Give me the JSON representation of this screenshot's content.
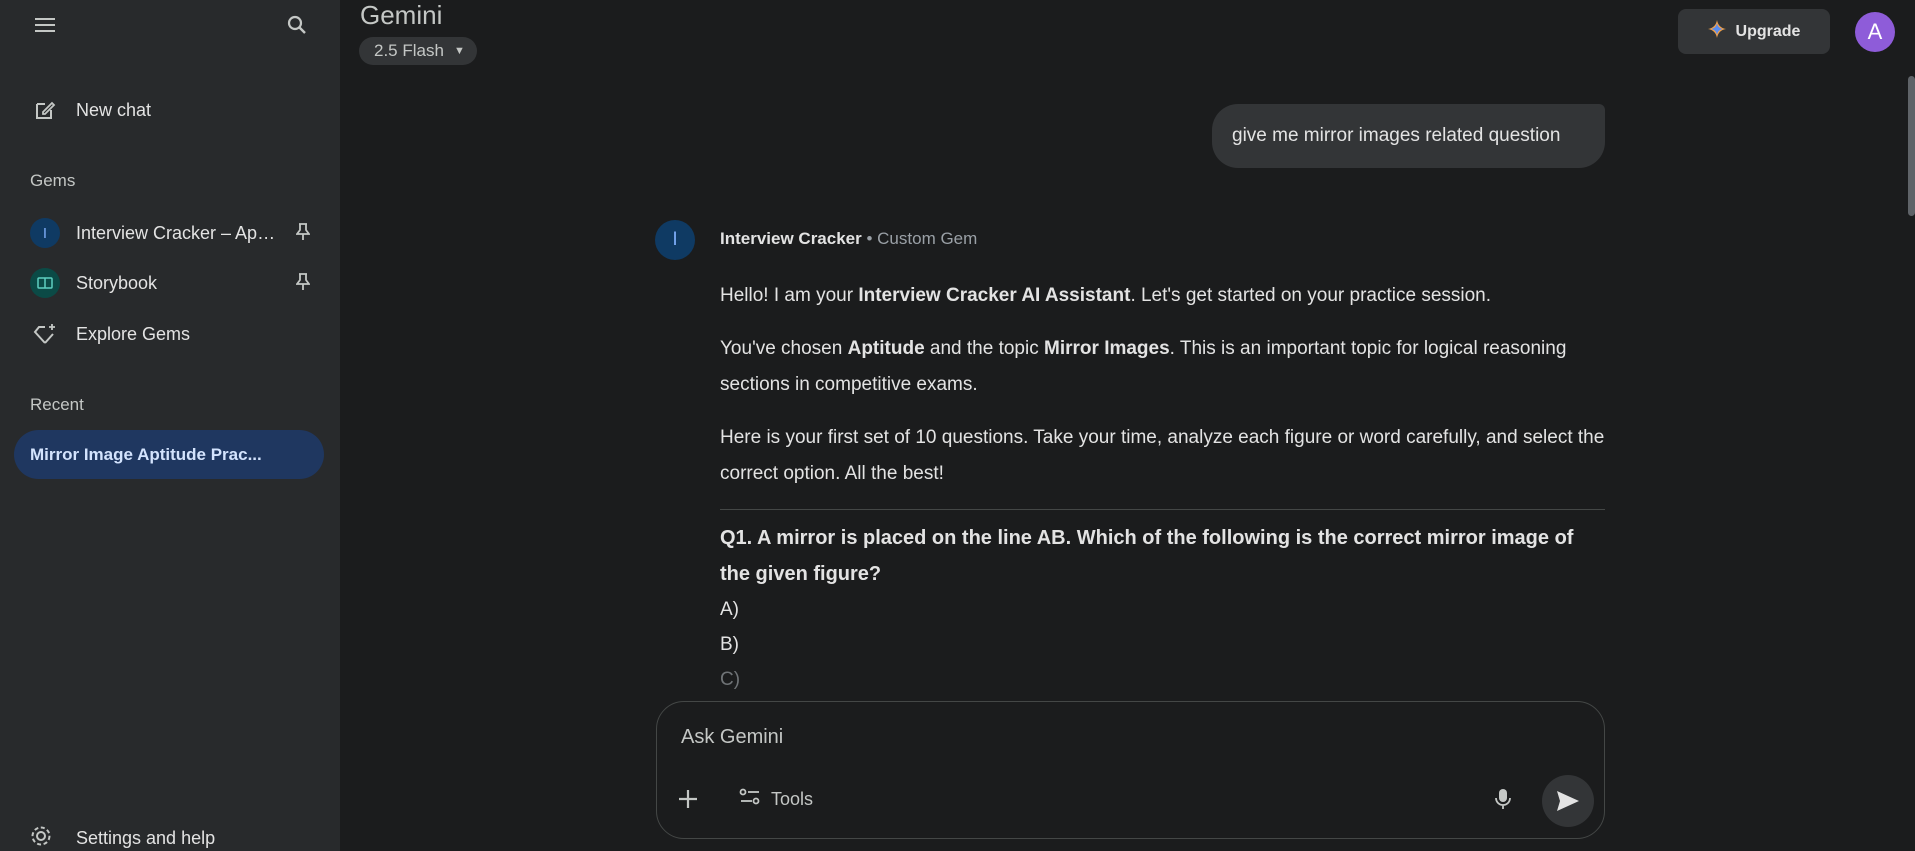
{
  "sidebar": {
    "new_chat": "New chat",
    "gems_title": "Gems",
    "gems": [
      {
        "label": "Interview Cracker – Apti...",
        "avatar": "I"
      },
      {
        "label": "Storybook"
      },
      {
        "label": "Explore Gems"
      }
    ],
    "recent_title": "Recent",
    "recent_items": [
      {
        "label": "Mirror Image Aptitude Prac..."
      }
    ],
    "settings": "Settings and help"
  },
  "header": {
    "title": "Gemini",
    "model": "2.5 Flash",
    "upgrade": "Upgrade",
    "avatar_letter": "A"
  },
  "chat": {
    "user_message": "give me mirror images related question",
    "gem_avatar": "I",
    "gem_name": "Interview Cracker",
    "gem_sep": " • ",
    "gem_type": "Custom Gem",
    "p1_a": "Hello! I am your ",
    "p1_b": "Interview Cracker AI Assistant",
    "p1_c": ". Let's get started on your practice session.",
    "p2_a": "You've chosen ",
    "p2_b": "Aptitude",
    "p2_c": " and the topic ",
    "p2_d": "Mirror Images",
    "p2_e": ". This is an important topic for logical reasoning sections in competitive exams.",
    "p3": "Here is your first set of 10 questions. Take your time, analyze each figure or word carefully, and select the correct option. All the best!",
    "q1": "Q1. A mirror is placed on the line AB. Which of the following is the correct mirror image of the given figure?",
    "options": [
      "A)",
      "B)",
      "C)"
    ]
  },
  "input": {
    "placeholder": "Ask Gemini",
    "tools": "Tools"
  },
  "colors": {
    "background": "#1b1c1d",
    "sidebar": "#282a2c",
    "recent_active": "#1f3760",
    "avatar": "#8e5cd9"
  }
}
